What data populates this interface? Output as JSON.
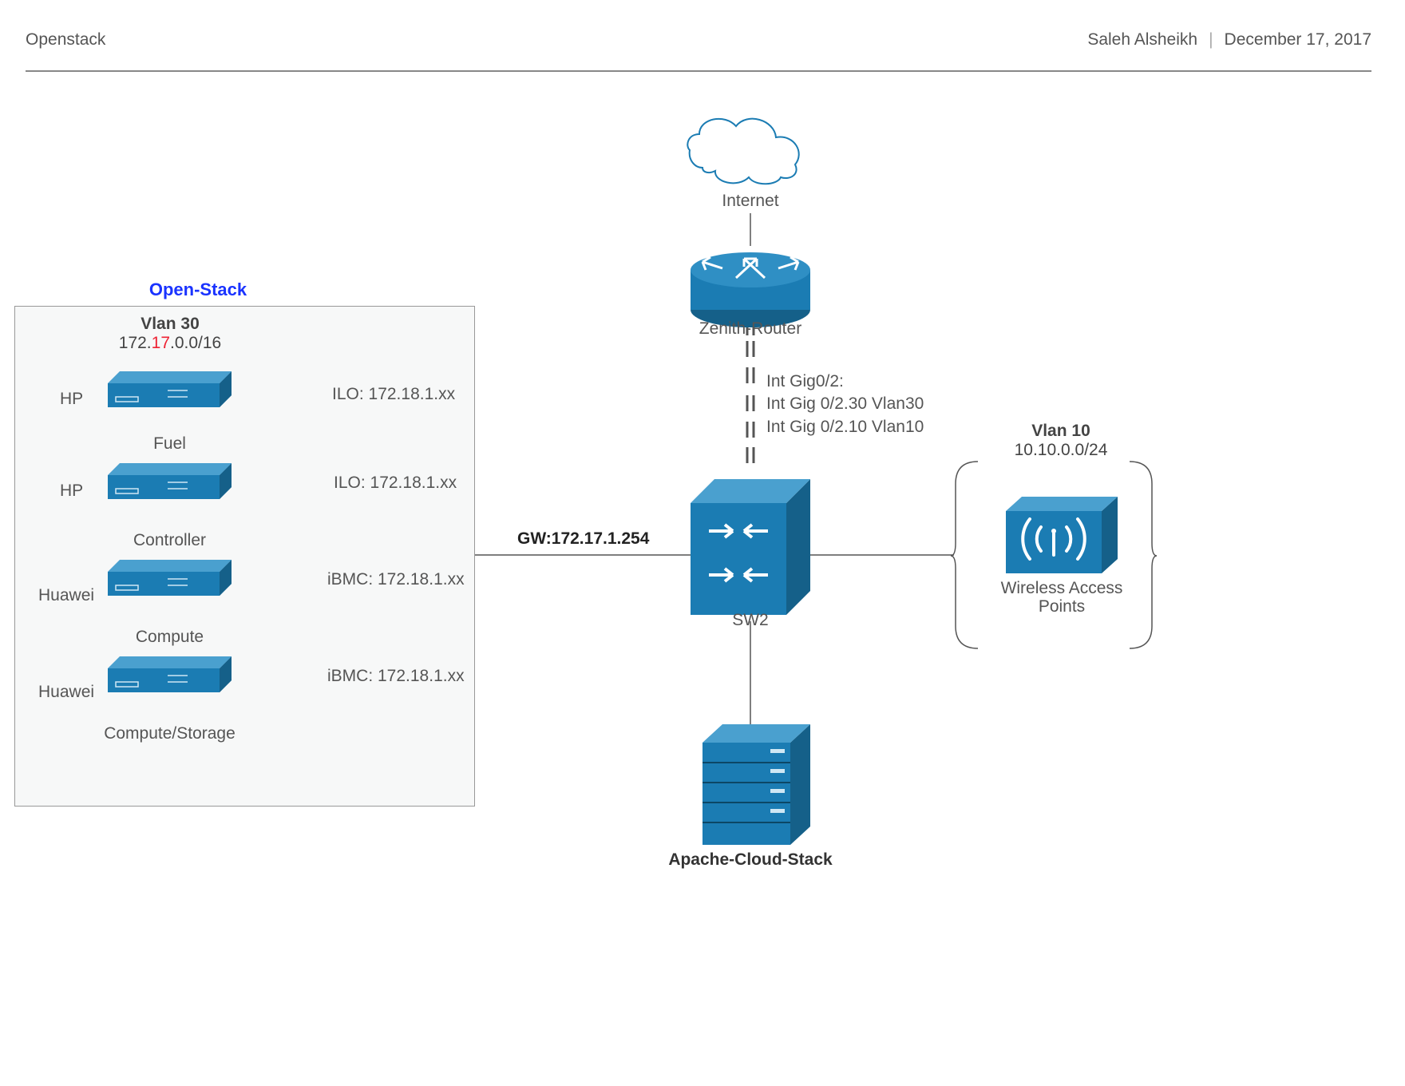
{
  "header": {
    "title": "Openstack",
    "author": "Saleh Alsheikh",
    "sep": "|",
    "date": "December 17, 2017"
  },
  "openstack": {
    "group_title": "Open-Stack",
    "vlan30": {
      "title": "Vlan 30",
      "subnet_pre": "172.",
      "subnet_red": "17",
      "subnet_post": ".0.0/16"
    },
    "servers": [
      {
        "vendor": "HP",
        "name": "Fuel",
        "mgmt": "ILO: 172.18.1.xx"
      },
      {
        "vendor": "HP",
        "name": "Controller",
        "mgmt": "ILO: 172.18.1.xx"
      },
      {
        "vendor": "Huawei",
        "name": "Compute",
        "mgmt": "iBMC: 172.18.1.xx"
      },
      {
        "vendor": "Huawei",
        "name": "Compute/Storage",
        "mgmt": "iBMC: 172.18.1.xx"
      }
    ],
    "gw": "GW:172.17.1.254"
  },
  "internet": {
    "label": "Internet"
  },
  "router": {
    "label": "Zenith-Router"
  },
  "router_ints": {
    "l1": "Int Gig0/2:",
    "l2": "Int Gig 0/2.30 Vlan30",
    "l3": "Int Gig 0/2.10 Vlan10"
  },
  "sw2": {
    "label": "SW2"
  },
  "vlan10": {
    "title": "Vlan 10",
    "subnet": "10.10.0.0/24",
    "wap_l1": "Wireless Access",
    "wap_l2": "Points"
  },
  "acs": {
    "label": "Apache-Cloud-Stack"
  }
}
